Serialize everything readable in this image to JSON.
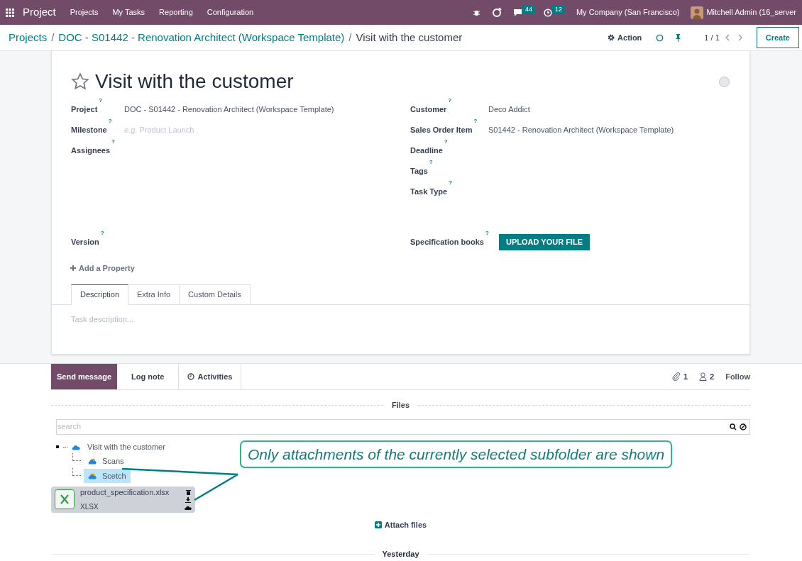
{
  "navbar": {
    "app_name": "Project",
    "menu": [
      "Projects",
      "My Tasks",
      "Reporting",
      "Configuration"
    ],
    "messages_count": "44",
    "activities_count": "12",
    "company": "My Company (San Francisco)",
    "user": "Mitchell Admin (16_server"
  },
  "breadcrumb": {
    "separators": [
      "/",
      "/"
    ],
    "items": [
      "Projects",
      "DOC - S01442 - Renovation Architect (Workspace Template)"
    ],
    "current": "Visit with the customer",
    "action": "Action",
    "pager": "1 / 1",
    "create": "Create"
  },
  "task": {
    "title": "Visit with the customer",
    "starred": false,
    "help_mark": "?",
    "left_fields": [
      {
        "label": "Project",
        "kind": "value",
        "value": "DOC - S01442 - Renovation Architect (Workspace Template)"
      },
      {
        "label": "Milestone",
        "kind": "placeholder",
        "placeholder": "e.g. Product Launch"
      },
      {
        "label": "Assignees",
        "kind": "empty"
      }
    ],
    "right_fields": [
      {
        "label": "Customer",
        "kind": "value",
        "value": "Deco Addict"
      },
      {
        "label": "Sales Order Item",
        "kind": "value",
        "value": "S01442 - Renovation Architect (Workspace Template)"
      },
      {
        "label": "Deadline",
        "kind": "empty"
      },
      {
        "label": "Tags",
        "kind": "empty"
      },
      {
        "label": "Task Type",
        "kind": "empty"
      }
    ],
    "version_label": "Version",
    "spec_label": "Specification books",
    "upload_button": "UPLOAD YOUR FILE",
    "add_property": "Add a Property",
    "tabs": [
      {
        "label": "Description",
        "selected": true
      },
      {
        "label": "Extra Info",
        "selected": false
      },
      {
        "label": "Custom Details",
        "selected": false
      }
    ],
    "description_placeholder": "Task description..."
  },
  "chatter": {
    "buttons": [
      {
        "label": "Send message",
        "selected": true,
        "kind": "text"
      },
      {
        "label": "Log note",
        "selected": false,
        "kind": "text"
      },
      {
        "label": "Activities",
        "selected": false,
        "kind": "clock"
      }
    ],
    "attachments_count": "1",
    "followers_count": "2",
    "follow": "Follow",
    "files_label": "Files",
    "search_placeholder": "search",
    "tree": {
      "label": "Visit with the customer",
      "children": [
        {
          "label": "Scans",
          "selected": false
        },
        {
          "label": "Scetch",
          "selected": true
        }
      ]
    },
    "file": {
      "name": "product_specification.xlsx",
      "type": "XLSX"
    },
    "attach": "Attach files",
    "date_separator": "Yesterday",
    "callout": "Only attachments of the currently selected subfolder are shown"
  }
}
